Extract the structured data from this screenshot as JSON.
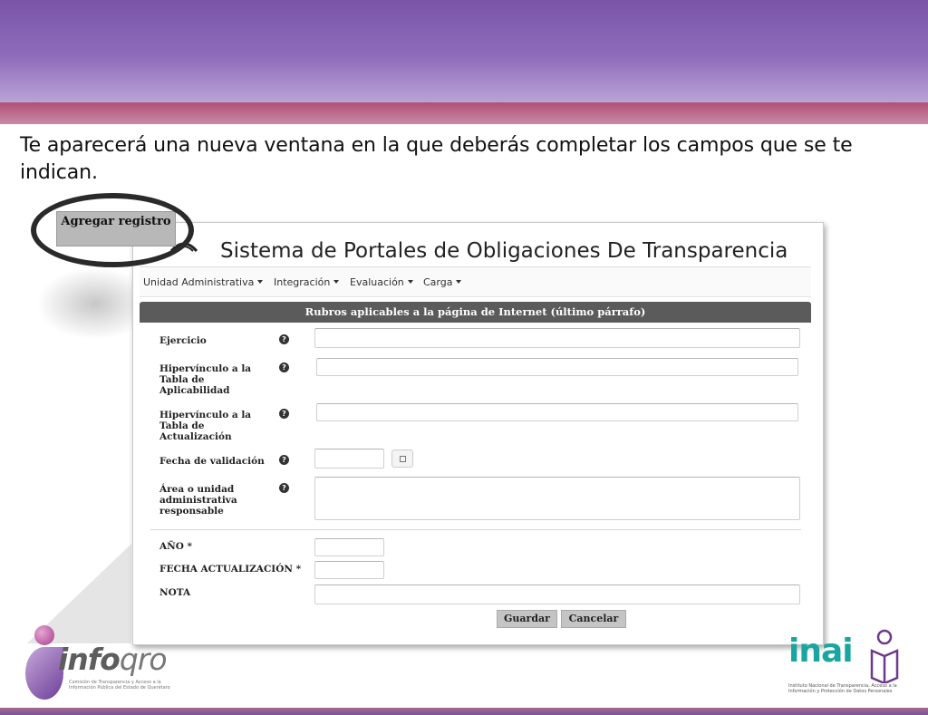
{
  "instruction": "Te aparecerá una nueva ventana en la que deberás completar los campos que se te indican.",
  "agregar_button": "Agregar registro",
  "window": {
    "title": "Sistema de Portales de Obligaciones De Transparencia",
    "nav": [
      "Unidad Administrativa",
      "Integración",
      "Evaluación",
      "Carga"
    ],
    "section_title": "Rubros aplicables a la página de Internet (último párrafo)",
    "fields": {
      "ejercicio": "Ejercicio",
      "hip_aplicabilidad": "Hipervínculo a la Tabla de Aplicabilidad",
      "hip_actualizacion": "Hipervínculo a la Tabla de Actualización",
      "fecha_validacion": "Fecha de validación",
      "area": "Área o unidad administrativa responsable",
      "anio": "AÑO *",
      "fecha_actualizacion": "FECHA ACTUALIZACIÓN *",
      "nota": "NOTA"
    },
    "help_glyph": "?",
    "buttons": {
      "guardar": "Guardar",
      "cancelar": "Cancelar"
    }
  },
  "logos": {
    "infoqro": {
      "info": "info",
      "qro": "qro",
      "caption": "Comisión de Transparencia y Acceso a la Información Pública del Estado de Querétaro"
    },
    "inai": {
      "name": "inai",
      "caption": "Instituto Nacional de Transparencia, Acceso a la Información y Protección de Datos Personales"
    }
  },
  "colors": {
    "header_purple": "#7a55a8",
    "band_pink": "#b05077",
    "section_bar": "#5b5b5b",
    "inai_teal": "#1aa6a0"
  }
}
